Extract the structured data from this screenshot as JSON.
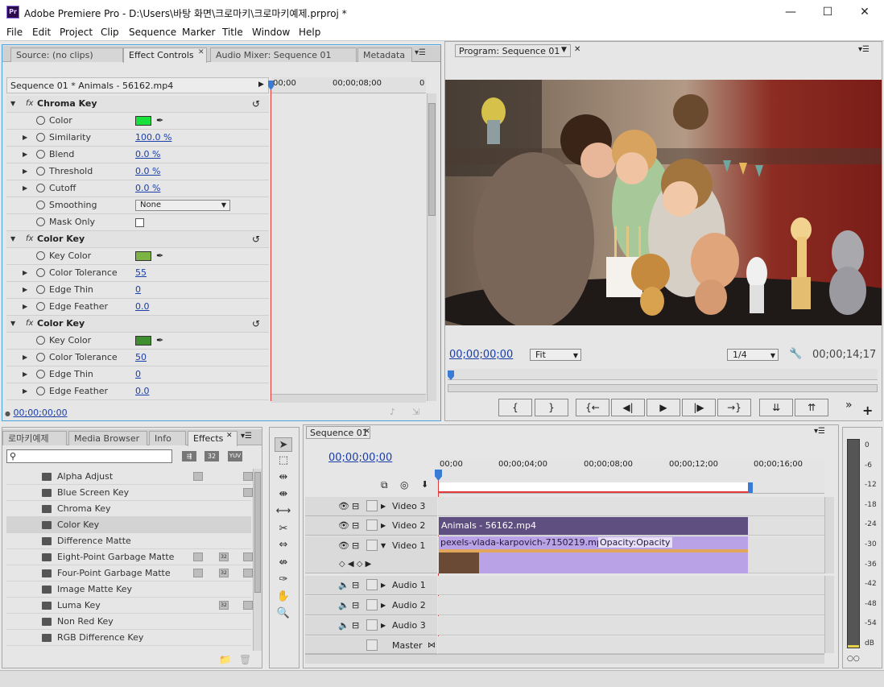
{
  "window": {
    "title": "Adobe Premiere Pro - D:\\Users\\바탕 화면\\크로마키\\크로마키예제.prproj *",
    "app_icon": "Pr",
    "minimize": "—",
    "maximize": "☐",
    "close": "✕"
  },
  "menu": [
    "File",
    "Edit",
    "Project",
    "Clip",
    "Sequence",
    "Marker",
    "Title",
    "Window",
    "Help"
  ],
  "source_panel": {
    "tabs": [
      "Source: (no clips)",
      "Effect Controls",
      "Audio Mixer: Sequence 01",
      "Metadata"
    ],
    "active_tab": "Effect Controls",
    "clip_header": "Sequence 01 * Animals - 56162.mp4",
    "ruler": [
      "00;00",
      "00;00;08;00",
      "0"
    ],
    "current_time": "00;00;00;00"
  },
  "effects": [
    {
      "name": "Chroma Key",
      "params": [
        {
          "label": "Color",
          "value": "",
          "color": "#19e03a",
          "expand": false
        },
        {
          "label": "Similarity",
          "value": "100.0 %",
          "expand": true
        },
        {
          "label": "Blend",
          "value": "0.0 %",
          "expand": true
        },
        {
          "label": "Threshold",
          "value": "0.0 %",
          "expand": true
        },
        {
          "label": "Cutoff",
          "value": "0.0 %",
          "expand": true
        },
        {
          "label": "Smoothing",
          "value": "None",
          "dropdown": true,
          "expand": false
        },
        {
          "label": "Mask Only",
          "value": "",
          "checkbox": true,
          "expand": false
        }
      ]
    },
    {
      "name": "Color Key",
      "params": [
        {
          "label": "Key Color",
          "value": "",
          "color": "#7cb342",
          "expand": false
        },
        {
          "label": "Color Tolerance",
          "value": "55",
          "expand": true
        },
        {
          "label": "Edge Thin",
          "value": "0",
          "expand": true
        },
        {
          "label": "Edge Feather",
          "value": "0.0",
          "expand": true
        }
      ]
    },
    {
      "name": "Color Key",
      "params": [
        {
          "label": "Key Color",
          "value": "",
          "color": "#3e8e2f",
          "expand": false
        },
        {
          "label": "Color Tolerance",
          "value": "50",
          "expand": true
        },
        {
          "label": "Edge Thin",
          "value": "0",
          "expand": true
        },
        {
          "label": "Edge Feather",
          "value": "0.0",
          "expand": true
        }
      ]
    }
  ],
  "program_panel": {
    "tab": "Program: Sequence 01",
    "current_time": "00;00;00;00",
    "fit": "Fit",
    "resolution": "1/4",
    "duration": "00;00;14;17",
    "transport": [
      "{",
      "}",
      "{←",
      "◀|",
      "▶",
      "|▶",
      "→}",
      "⇊",
      "⇈"
    ],
    "overflow": "»",
    "add": "+"
  },
  "project_panel": {
    "tabs": [
      "로마키예제",
      "Media Browser",
      "Info",
      "Effects"
    ],
    "active_tab": "Effects",
    "search_placeholder": "",
    "badges": [
      "32",
      "YUV"
    ],
    "items": [
      {
        "name": "Alpha Adjust",
        "badges": [
          "acc",
          "yuv"
        ]
      },
      {
        "name": "Blue Screen Key",
        "badges": [
          "yuv"
        ]
      },
      {
        "name": "Chroma Key",
        "badges": []
      },
      {
        "name": "Color Key",
        "badges": [],
        "selected": true
      },
      {
        "name": "Difference Matte",
        "badges": []
      },
      {
        "name": "Eight-Point Garbage Matte",
        "badges": [
          "acc",
          "32",
          "yuv"
        ]
      },
      {
        "name": "Four-Point Garbage Matte",
        "badges": [
          "acc",
          "32",
          "yuv"
        ]
      },
      {
        "name": "Image Matte Key",
        "badges": []
      },
      {
        "name": "Luma Key",
        "badges": [
          "32",
          "yuv"
        ]
      },
      {
        "name": "Non Red Key",
        "badges": []
      },
      {
        "name": "RGB Difference Key",
        "badges": []
      }
    ]
  },
  "timeline": {
    "tab": "Sequence 01",
    "current_time": "00;00;00;00",
    "ruler": [
      "00;00",
      "00;00;04;00",
      "00;00;08;00",
      "00;00;12;00",
      "00;00;16;00"
    ],
    "video_tracks": [
      "Video 3",
      "Video 2",
      "Video 1"
    ],
    "audio_tracks": [
      "Audio 1",
      "Audio 2",
      "Audio 3"
    ],
    "master": "Master",
    "clip_v2": "Animals - 56162.mp4",
    "clip_v1": "pexels-vlada-karpovich-7150219.mp4",
    "clip_v1_fx": "Opacity:Opacity"
  },
  "meter": {
    "labels": [
      "0",
      "-6",
      "-12",
      "-18",
      "-24",
      "-30",
      "-36",
      "-42",
      "-48",
      "-54",
      "dB"
    ]
  },
  "tools": [
    "selection-tool",
    "track-select-tool",
    "ripple-edit-tool",
    "rolling-edit-tool",
    "rate-stretch-tool",
    "razor-tool",
    "slip-tool",
    "slide-tool",
    "pen-tool",
    "hand-tool",
    "zoom-tool"
  ],
  "colors": {
    "accent_blue": "#1a3ea8",
    "playhead_red": "#e03a3a",
    "clip_v2": "#5e4f80",
    "clip_v1": "#b9a2e6"
  }
}
